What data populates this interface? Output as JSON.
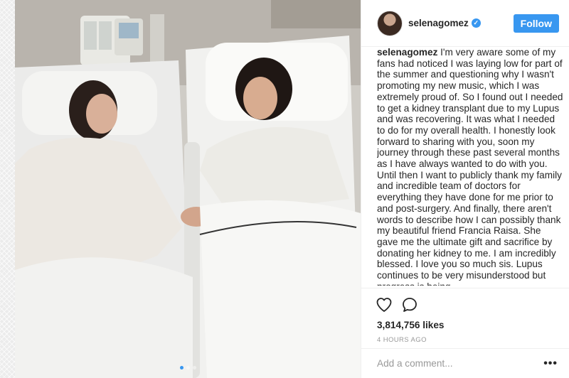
{
  "post": {
    "carousel": {
      "count": 3,
      "active_index": 0
    }
  },
  "profile": {
    "username": "selenagomez",
    "verified_symbol": "✓",
    "follow_label": "Follow",
    "accent_color": "#3897f0"
  },
  "caption": {
    "username": "selenagomez",
    "text": "I'm very aware some of my fans had noticed I was laying low for part of the summer and questioning why I wasn't promoting my new music, which I was extremely proud of. So I found out I needed to get a kidney transplant due to my Lupus and was recovering. It was what I needed to do for my overall health. I honestly look forward to sharing with you, soon my journey through these past several months as I have always wanted to do with you. Until then I want to publicly thank my family and incredible team of doctors for everything they have done for me prior to and post-surgery. And finally, there aren't words to describe how I can possibly thank my beautiful friend Francia Raisa. She gave me the ultimate gift and sacrifice by donating her kidney to me. I am incredibly blessed. I love you so much sis. Lupus continues to be very misunderstood but progress is being"
  },
  "actions": {
    "like_icon": "heart-icon",
    "comment_icon": "comment-icon"
  },
  "stats": {
    "likes": "3,814,756 likes",
    "timestamp": "4 HOURS AGO"
  },
  "comment": {
    "placeholder": "Add a comment...",
    "more_label": "•••"
  }
}
